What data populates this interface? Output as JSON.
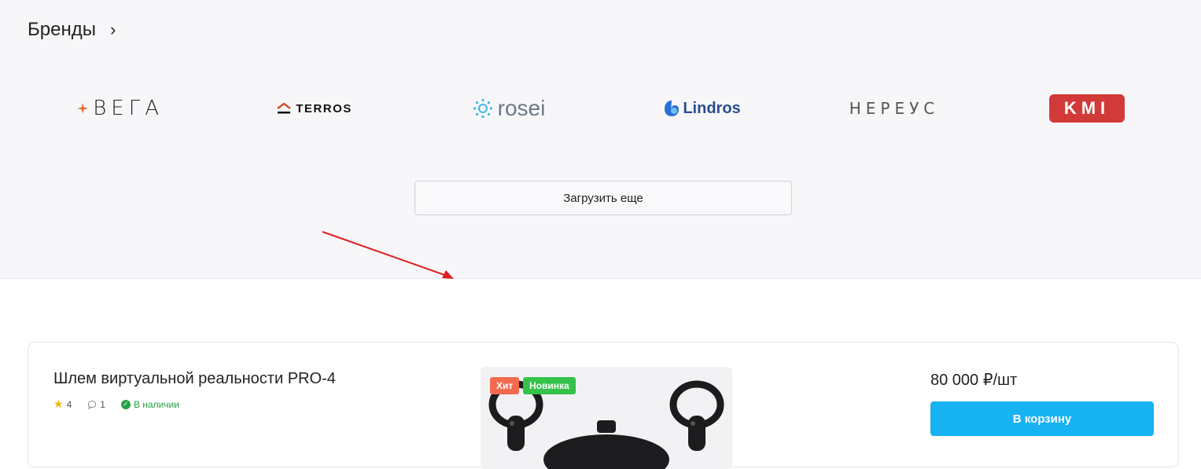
{
  "brands_section": {
    "title": "Бренды",
    "chevron": "›",
    "logos": [
      {
        "name": "ВЕГА",
        "icon": "four-point-star-icon",
        "color": "#e8672b"
      },
      {
        "name": "TERROS",
        "icon": "house-roof-icon",
        "color": "#d2522b"
      },
      {
        "name": "rosei",
        "icon": "sun-icon",
        "color": "#3fb7e6"
      },
      {
        "name": "Lindros",
        "icon": "drop-leaf-icon",
        "color": "#2a6fd6"
      },
      {
        "name": "НЕРЕУС",
        "icon": "",
        "color": "#555555"
      },
      {
        "name": "KMI",
        "icon": "",
        "color": "#d23a3a"
      }
    ],
    "load_more_label": "Загрузить еще"
  },
  "annotation": {
    "arrow_color": "#e02020"
  },
  "product": {
    "title": "Шлем виртуальной реальности PRO-4",
    "rating": "4",
    "reviews": "1",
    "stock_status": "В наличии",
    "badges": {
      "hit": "Хит",
      "new": "Новинка"
    },
    "price": "80 000 ₽/шт",
    "cart_label": "В корзину",
    "accent_color": "#17b2f2"
  }
}
